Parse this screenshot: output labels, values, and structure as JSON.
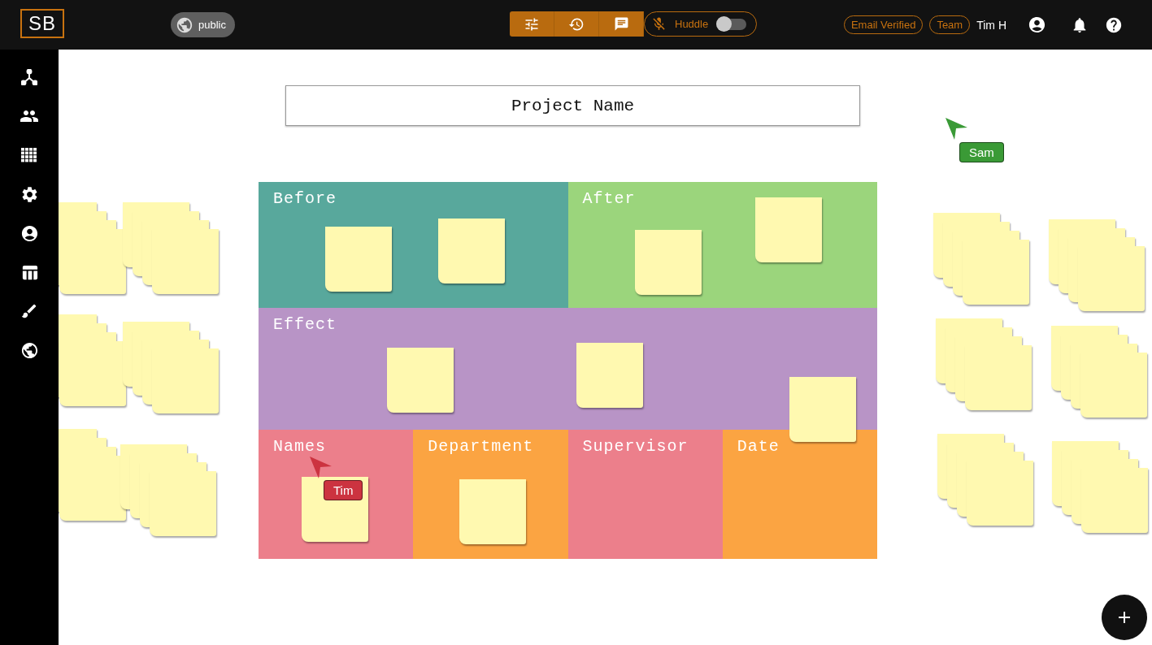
{
  "logo": "SB",
  "visibility": {
    "label": "public"
  },
  "huddle": {
    "label": "Huddle",
    "on": false
  },
  "badges": [
    "Email Verified",
    "Team"
  ],
  "user": {
    "name": "Tim H"
  },
  "project": {
    "value": "Project Name"
  },
  "board": {
    "rows": [
      {
        "sections": [
          {
            "label": "Before",
            "color": "#58a89c"
          },
          {
            "label": "After",
            "color": "#9bd57c"
          }
        ]
      },
      {
        "sections": [
          {
            "label": "Effect",
            "color": "#b894c6"
          }
        ]
      },
      {
        "sections": [
          {
            "label": "Names",
            "color": "#ec7f8b"
          },
          {
            "label": "Department",
            "color": "#fba442"
          },
          {
            "label": "Supervisor",
            "color": "#ec7f8b"
          },
          {
            "label": "Date",
            "color": "#fba442"
          }
        ]
      }
    ]
  },
  "cursors": [
    {
      "name": "Sam",
      "color": "#3a9a36"
    },
    {
      "name": "Tim",
      "color": "#cc3340"
    }
  ]
}
